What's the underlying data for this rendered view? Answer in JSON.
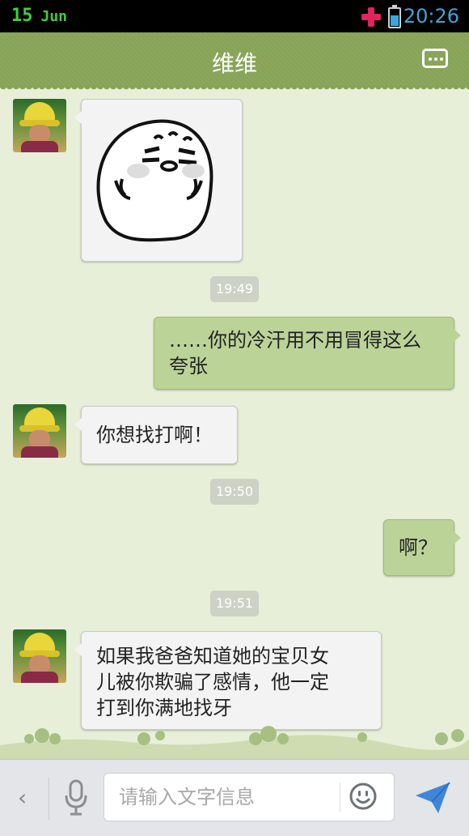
{
  "status_bar": {
    "day": "15",
    "month": "Jun",
    "time": "20:26",
    "icons": [
      "medical-cross-icon",
      "battery-icon"
    ]
  },
  "header": {
    "title": "维维",
    "menu_icon": "chat-menu-icon"
  },
  "messages": [
    {
      "type": "sticker",
      "sender": "contact",
      "sticker": "seal-sticker"
    },
    {
      "type": "time",
      "text": "19:49"
    },
    {
      "type": "text",
      "sender": "me",
      "lines": [
        "……你的冷汗用不用冒得这么",
        "夸张"
      ]
    },
    {
      "type": "text",
      "sender": "contact",
      "lines": [
        "你想找打啊！"
      ]
    },
    {
      "type": "time",
      "text": "19:50"
    },
    {
      "type": "text",
      "sender": "me",
      "lines": [
        "啊？"
      ]
    },
    {
      "type": "time",
      "text": "19:51"
    },
    {
      "type": "text",
      "sender": "contact",
      "lines": [
        "如果我爸爸知道她的宝贝女",
        "儿被你欺骗了感情，他一定",
        "打到你满地找牙"
      ]
    }
  ],
  "input_bar": {
    "placeholder": "请输入文字信息",
    "icons": [
      "back-arrow-icon",
      "microphone-icon",
      "smiley-icon",
      "send-icon"
    ]
  },
  "colors": {
    "header": "#86a356",
    "background": "#e7efd9",
    "bubble_out": "#bcd398",
    "bubble_in": "#f3f3f3"
  }
}
